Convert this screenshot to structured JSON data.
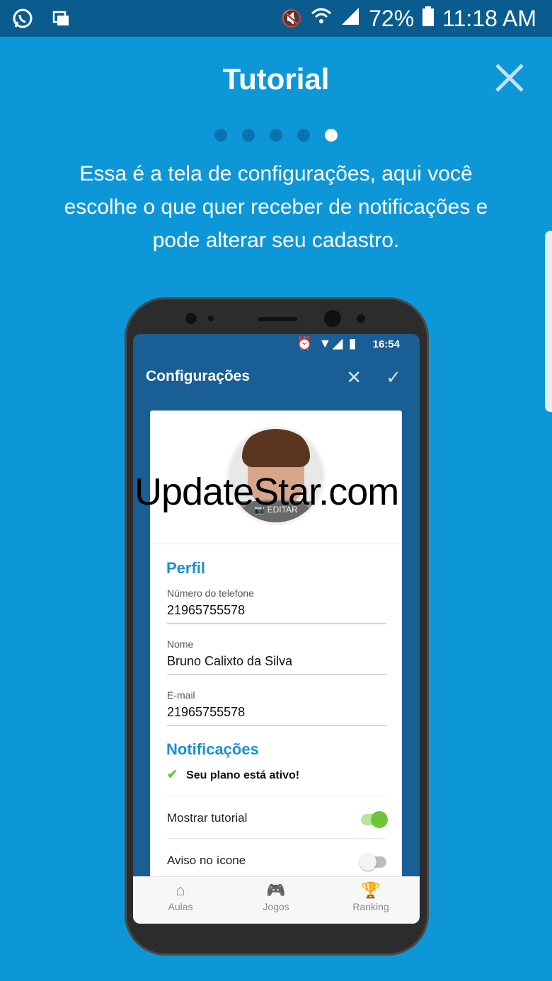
{
  "status_bar": {
    "battery": "72%",
    "time": "11:18 AM",
    "left_icons": [
      "whatsapp-icon",
      "messages-icon"
    ],
    "right_icons": [
      "mute-icon",
      "wifi-icon",
      "signal-icon",
      "battery-icon"
    ]
  },
  "header": {
    "title": "Tutorial",
    "close_icon": "close-icon"
  },
  "pager": {
    "total": 5,
    "active_index": 4
  },
  "description": "Essa é a tela de configurações, aqui você escolhe o que quer receber de notificações e pode alterar seu cadastro.",
  "phone": {
    "status": {
      "time": "16:54",
      "icons": "⏰ ▼◢ ▮"
    },
    "app_header": {
      "title": "Configurações",
      "cancel_icon": "close-icon",
      "confirm_icon": "check-icon"
    },
    "avatar": {
      "edit_label": "EDITAR"
    },
    "profile": {
      "section_title": "Perfil",
      "fields": [
        {
          "label": "Número do telefone",
          "value": "21965755578"
        },
        {
          "label": "Nome",
          "value": "Bruno Calixto da Silva"
        },
        {
          "label": "E-mail",
          "value": "21965755578"
        }
      ]
    },
    "notifications": {
      "section_title": "Notificações",
      "plan_status": "Seu plano está ativo!",
      "rows": [
        {
          "label": "Mostrar tutorial",
          "on": true
        },
        {
          "label": "Aviso no ícone",
          "on": false
        }
      ]
    },
    "tabs": [
      {
        "label": "Aulas",
        "icon": "home-icon"
      },
      {
        "label": "Jogos",
        "icon": "gamepad-icon"
      },
      {
        "label": "Ranking",
        "icon": "trophy-icon"
      }
    ]
  },
  "watermark": "UpdateStar.com",
  "colors": {
    "background": "#0d97d8",
    "status_bar": "#0a5c8f",
    "accent": "#1d8fd0",
    "toggle_on": "#6cc63a"
  }
}
